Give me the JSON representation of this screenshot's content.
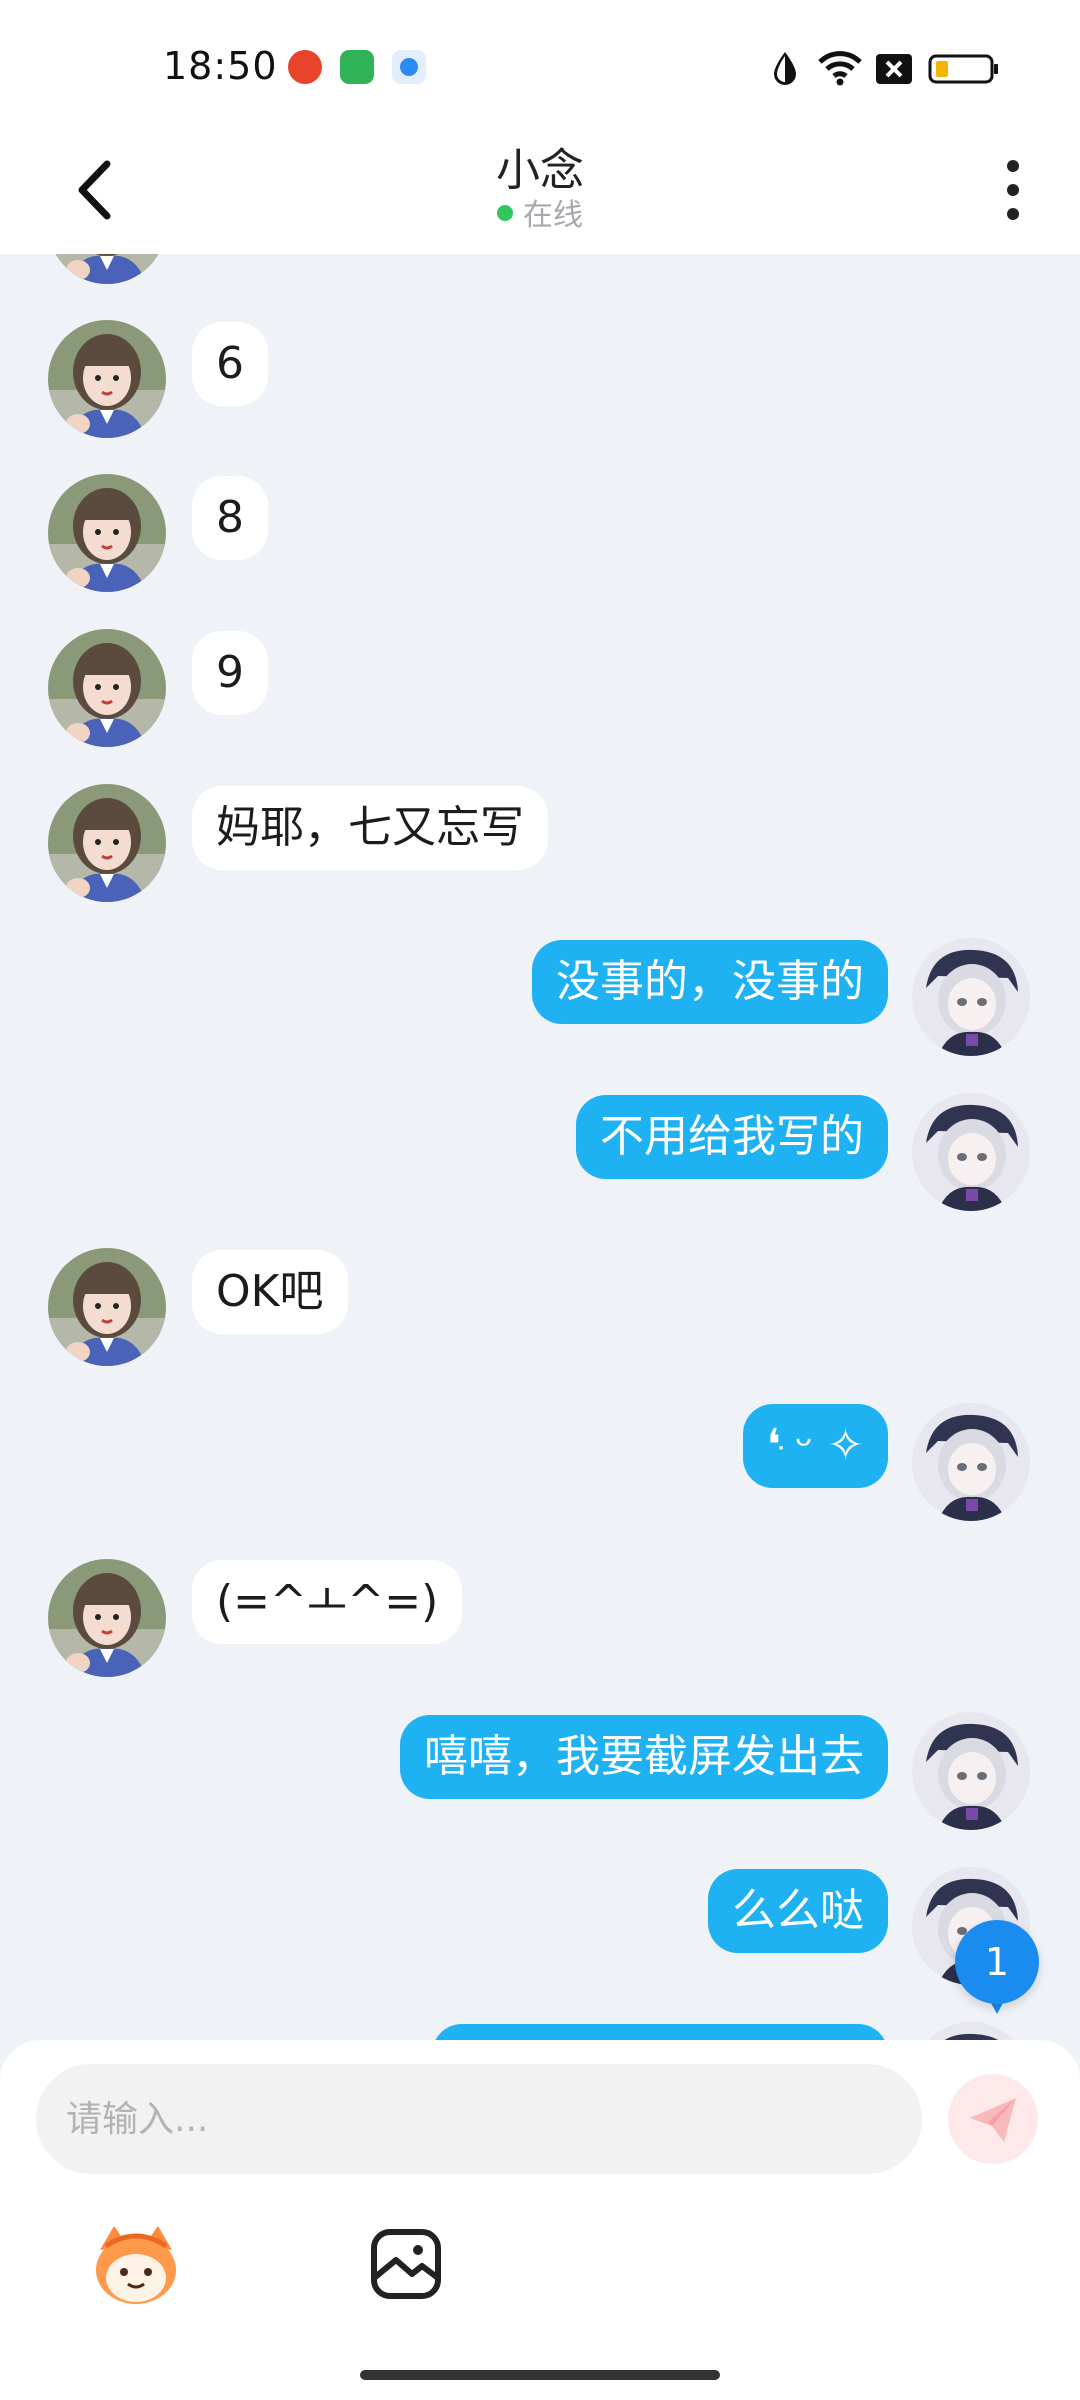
{
  "status_bar": {
    "time": "18:50",
    "app_icons": [
      "app-red-icon",
      "app-green-bag-icon",
      "app-blue-icon"
    ],
    "indicators": [
      "drop-icon",
      "wifi-icon",
      "sim-off-icon",
      "battery-icon"
    ],
    "colors": {
      "red_app": "#e8442c",
      "green_app": "#2fb356",
      "blue_app": "#2b8bf5"
    }
  },
  "header": {
    "title": "小念",
    "status_text": "在线",
    "back_icon": "chevron-left-icon",
    "more_icon": "more-vertical-icon"
  },
  "messages": [
    {
      "side": "in",
      "text": "6"
    },
    {
      "side": "in",
      "text": "8"
    },
    {
      "side": "in",
      "text": "9"
    },
    {
      "side": "in",
      "text": "妈耶，七又忘写"
    },
    {
      "side": "out",
      "text": "没事的，没事的"
    },
    {
      "side": "out",
      "text": "不用给我写的"
    },
    {
      "side": "in",
      "text": "OK吧"
    },
    {
      "side": "out",
      "text": "❛ּ ᵕ ✧"
    },
    {
      "side": "in",
      "text": "(=^ㅗ^=)"
    },
    {
      "side": "out",
      "text": "嘻嘻，我要截屏发出去"
    },
    {
      "side": "out",
      "text": "么么哒"
    }
  ],
  "unread_badge": {
    "count": "1"
  },
  "composer": {
    "placeholder": "请输入...",
    "send_icon": "paper-plane-icon",
    "tools": [
      "emoji-mascot-icon",
      "image-icon"
    ]
  },
  "colors": {
    "background": "#eff2f7",
    "incoming_bubble": "#ffffff",
    "outgoing_bubble": "#1fb2f2",
    "online_dot": "#2ec95a",
    "badge": "#1a8cf0",
    "send_button": "#fde9ea"
  }
}
